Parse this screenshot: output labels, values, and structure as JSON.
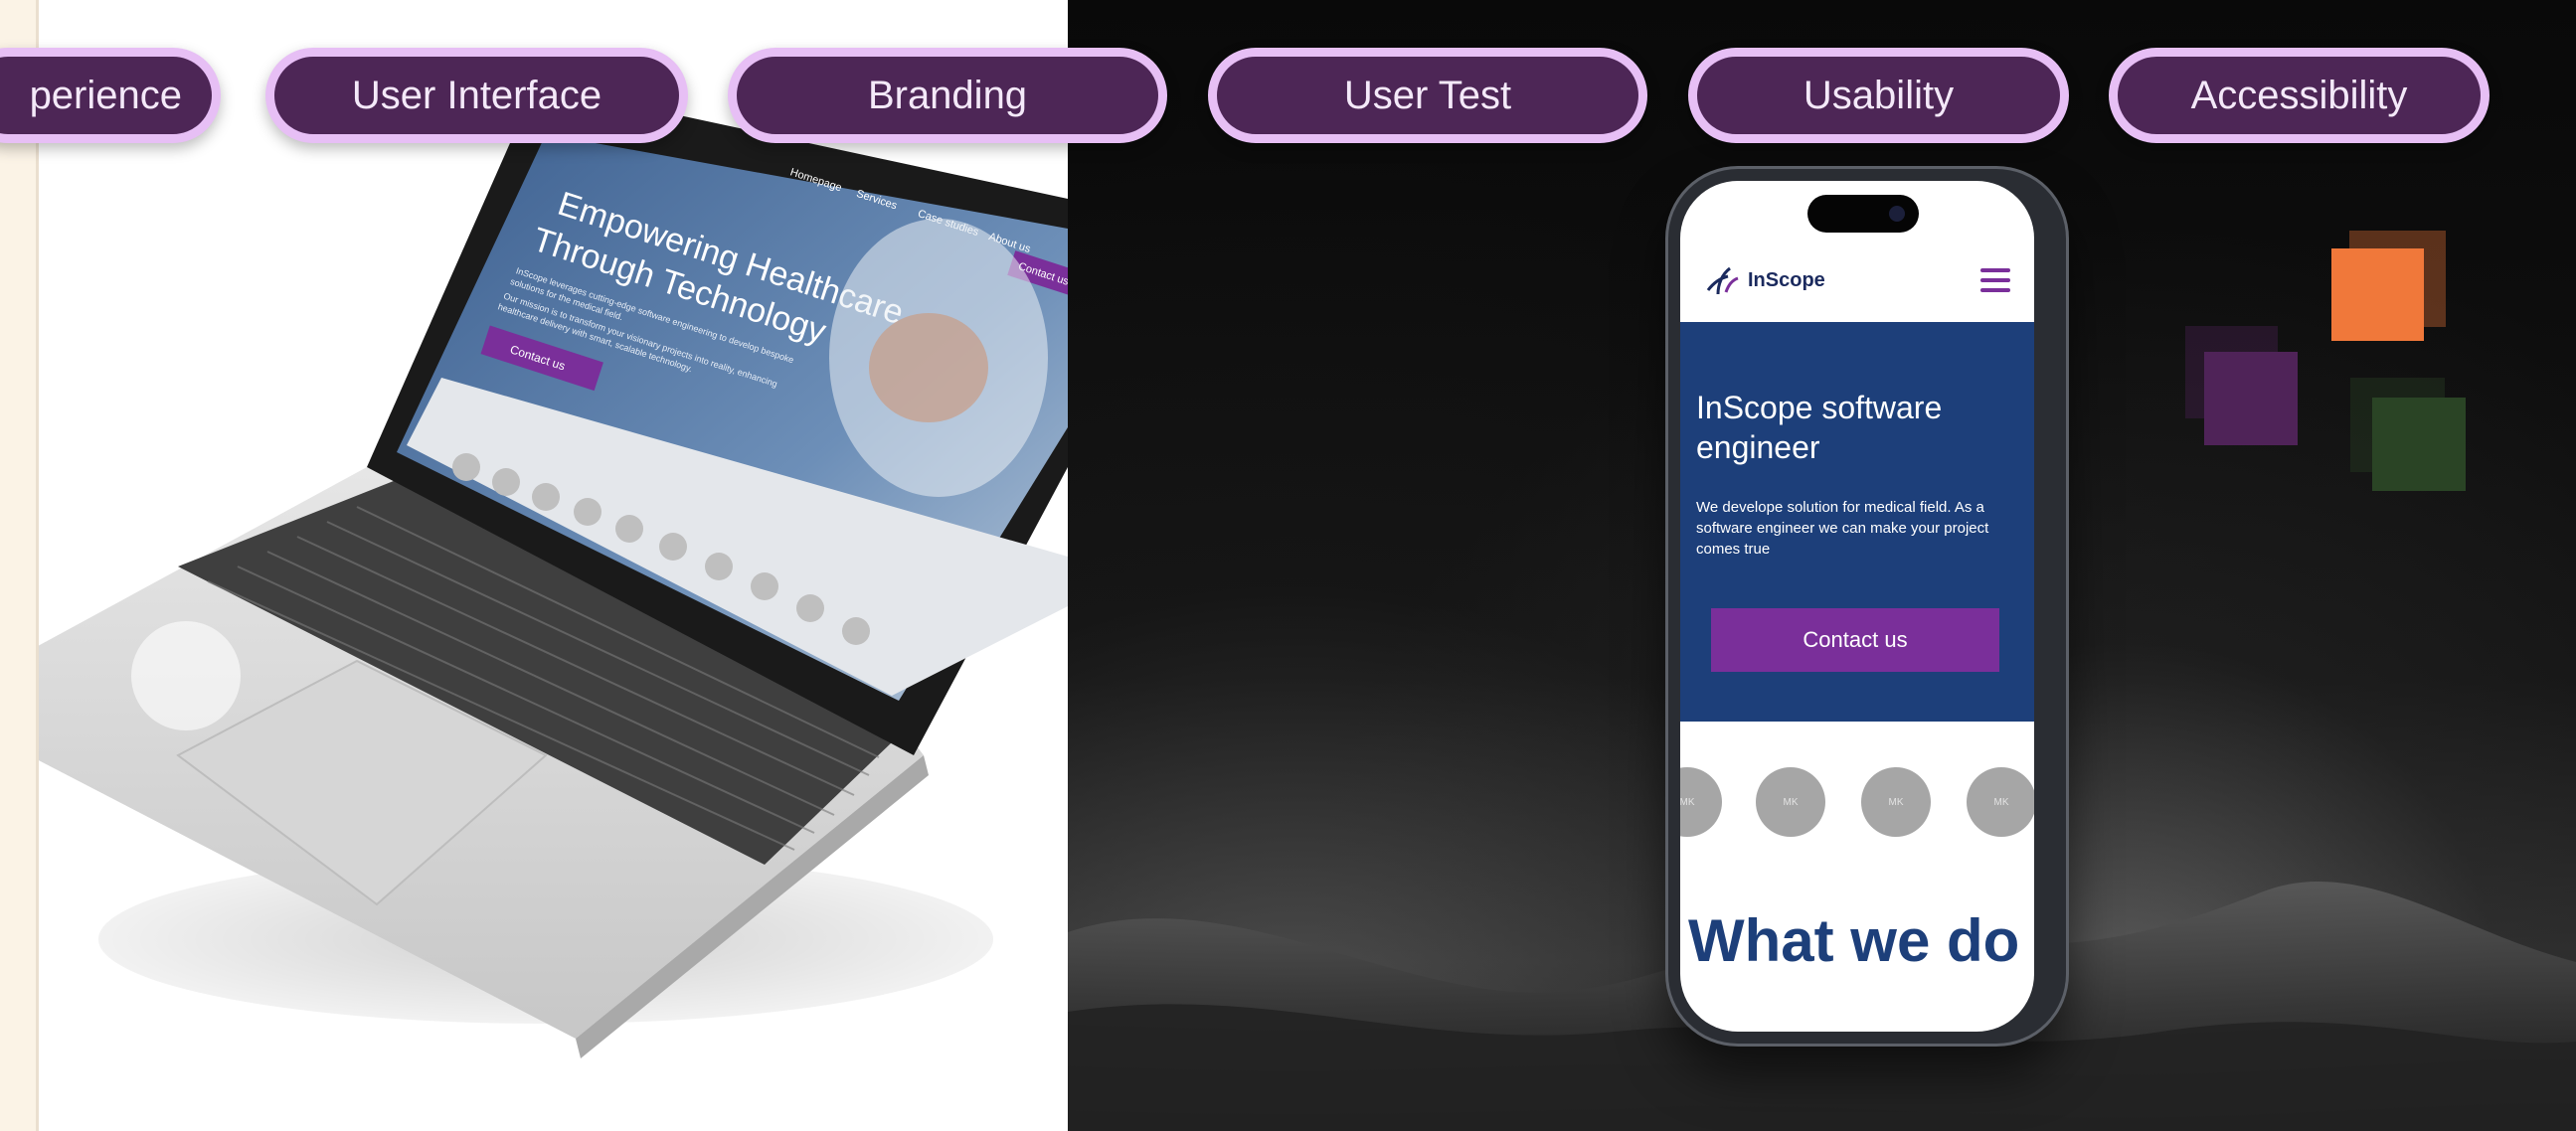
{
  "tags": [
    "perience",
    "User Interface",
    "Branding",
    "User Test",
    "Usability",
    "Accessibility"
  ],
  "laptop_site": {
    "nav": [
      "Homepage",
      "Services",
      "Case studies",
      "About us"
    ],
    "nav_button": "Contact us",
    "hero_title_line1": "Empowering Healthcare",
    "hero_title_line2": "Through Technology",
    "hero_text_1": "InScope leverages cutting-edge software engineering to develop bespoke",
    "hero_text_2": "solutions for the medical field.",
    "hero_text_3": "Our mission is to transform your visionary projects into reality, enhancing",
    "hero_text_4": "healthcare delivery with smart, scalable technology.",
    "cta": "Contact us"
  },
  "phone_site": {
    "logo": "InScope",
    "hero_title": "InScope software engineer",
    "hero_text": "We develope solution for medical field. As a software engineer we can make your project comes true",
    "cta": "Contact us",
    "circle_label": "MK",
    "section_title": "What we do ?"
  },
  "squares": {
    "orange": "#f0783a",
    "purple": "#4f2358",
    "green": "#2a4425"
  }
}
